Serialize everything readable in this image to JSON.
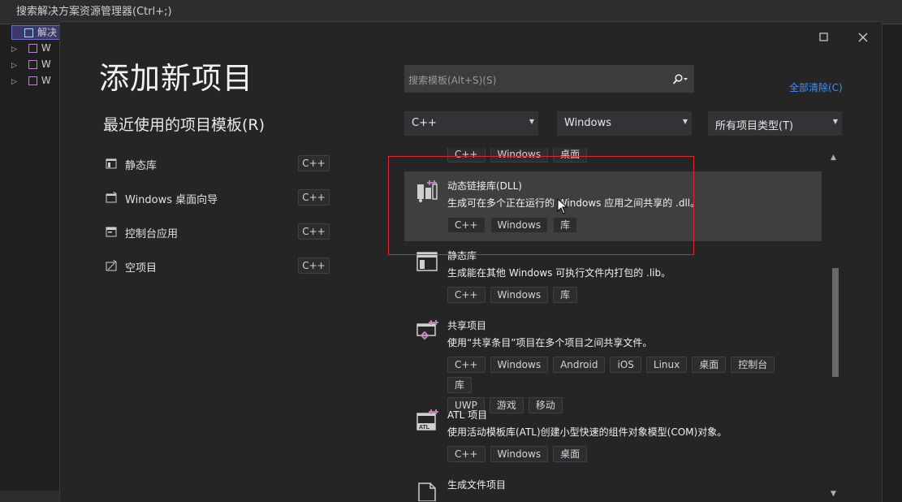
{
  "background": {
    "search_placeholder": "搜索解决方案资源管理器(Ctrl+;)",
    "solution_item": "解决",
    "tree_items": [
      "W",
      "W",
      "W"
    ]
  },
  "dialog": {
    "title": "添加新项目",
    "maximize_icon": "maximize-icon",
    "close_icon": "close-icon"
  },
  "recent": {
    "heading": "最近使用的项目模板(R)",
    "items": [
      {
        "label": "静态库",
        "tag": "C++"
      },
      {
        "label": "Windows 桌面向导",
        "tag": "C++"
      },
      {
        "label": "控制台应用",
        "tag": "C++"
      },
      {
        "label": "空项目",
        "tag": "C++"
      }
    ]
  },
  "search": {
    "placeholder": "搜索模板(Alt+S)(S)",
    "clear_all": "全部清除(C)"
  },
  "filters": {
    "language": "C++",
    "platform": "Windows",
    "project_type": "所有项目类型(T)"
  },
  "templates": [
    {
      "name": "",
      "desc": "",
      "tags": [
        "C++",
        "Windows",
        "桌面"
      ]
    },
    {
      "name": "动态链接库(DLL)",
      "desc": "生成可在多个正在运行的 Windows 应用之间共享的 .dll。",
      "tags": [
        "C++",
        "Windows",
        "库"
      ]
    },
    {
      "name": "静态库",
      "desc": "生成能在其他 Windows 可执行文件内打包的 .lib。",
      "tags": [
        "C++",
        "Windows",
        "库"
      ]
    },
    {
      "name": "共享项目",
      "desc": "使用“共享条目”项目在多个项目之间共享文件。",
      "tags": [
        "C++",
        "Windows",
        "Android",
        "iOS",
        "Linux",
        "桌面",
        "控制台",
        "库",
        "UWP",
        "游戏",
        "移动"
      ]
    },
    {
      "name": "ATL 项目",
      "desc": "使用活动模板库(ATL)创建小型快速的组件对象模型(COM)对象。",
      "tags": [
        "C++",
        "Windows",
        "桌面"
      ]
    },
    {
      "name": "生成文件项目",
      "desc": "",
      "tags": []
    }
  ],
  "colors": {
    "accent_link": "#3794ff",
    "selection_bg": "#3f3f3f",
    "highlight_box": "#e0242f"
  }
}
